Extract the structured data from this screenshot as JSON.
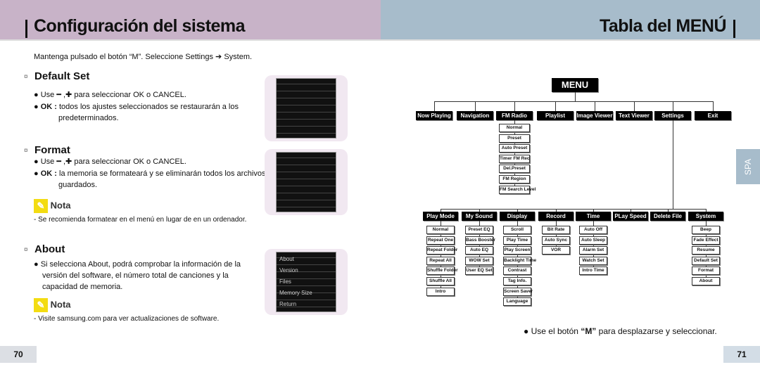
{
  "left": {
    "title": "Configuración del sistema",
    "intro": "Mantenga pulsado el botón “M”. Seleccione Settings ➔ System.",
    "sections": [
      {
        "heading": "Default Set",
        "bullets": [
          {
            "bold": "",
            "text": "Use ━ ,✚ para seleccionar OK o CANCEL."
          },
          {
            "bold": "OK :",
            "text": "todos los ajustes seleccionados se restaurarán a los predeterminados."
          }
        ]
      },
      {
        "heading": "Format",
        "bullets": [
          {
            "bold": "",
            "text": "Use ━ ,✚ para seleccionar OK o CANCEL."
          },
          {
            "bold": "OK :",
            "text": "la memoria se formateará y se eliminarán todos los archivos guardados."
          }
        ],
        "note_title": "Nota",
        "note": "- Se recomienda formatear en el menú en lugar de en un ordenador."
      },
      {
        "heading": "About",
        "bullets": [
          {
            "bold": "",
            "text": "Si selecciona About, podrá comprobar la información de la versión del software, el número total de canciones y la capacidad de memoria."
          }
        ],
        "note_title": "Nota",
        "note": "- Visite samsung.com para ver actualizaciones de software."
      }
    ],
    "about_screen": [
      "About",
      "Version",
      "Files",
      "Memory Size",
      "Return"
    ],
    "page": "70"
  },
  "right": {
    "title": "Tabla del MENÚ",
    "side_tab": "SPA",
    "footer_prefix": "Use el botón ",
    "footer_bold": "“M”",
    "footer_suffix": " para desplazarse y seleccionar.",
    "page": "71",
    "menu_root": "MENU",
    "top": [
      {
        "label": "Now Playing"
      },
      {
        "label": "Navigation"
      },
      {
        "label": "FM Radio",
        "subs": [
          "Normal",
          "Preset",
          "Auto Preset",
          "Timer FM Rec",
          "Del.Preset",
          "FM Region",
          "FM Search Level"
        ]
      },
      {
        "label": "Playlist"
      },
      {
        "label": "Image Viewer"
      },
      {
        "label": "Text Viewer"
      },
      {
        "label": "Settings"
      },
      {
        "label": "Exit"
      }
    ],
    "settings": [
      {
        "label": "Play Mode",
        "subs": [
          "Normal",
          "Repeat One",
          "Repeat Folder",
          "Repeat All",
          "Shuffle Folder",
          "Shuffle All",
          "Intro"
        ]
      },
      {
        "label": "My Sound",
        "subs": [
          "Preset EQ",
          "Bass Booster",
          "Auto EQ",
          "WOW Set",
          "User EQ Set"
        ]
      },
      {
        "label": "Display",
        "subs": [
          "Scroll",
          "Play Time",
          "Play Screen",
          "Backlight Time",
          "Contrast",
          "Tag Info.",
          "Screen Saver",
          "Language"
        ]
      },
      {
        "label": "Record",
        "subs": [
          "Bit Rate",
          "Auto Sync",
          "VOR"
        ]
      },
      {
        "label": "Time",
        "subs": [
          "Auto Off",
          "Auto Sleep",
          "Alarm Set",
          "Watch Set",
          "Intro Time"
        ]
      },
      {
        "label": "PLay Speed"
      },
      {
        "label": "Delete File"
      },
      {
        "label": "System",
        "subs": [
          "Beep",
          "Fade Effect",
          "Resume",
          "Default Set",
          "Format",
          "About"
        ]
      }
    ]
  },
  "colors": {
    "left_header": "#c8b3c8",
    "right_header": "#a7bccb",
    "nota_icon": "#f3dc12"
  }
}
